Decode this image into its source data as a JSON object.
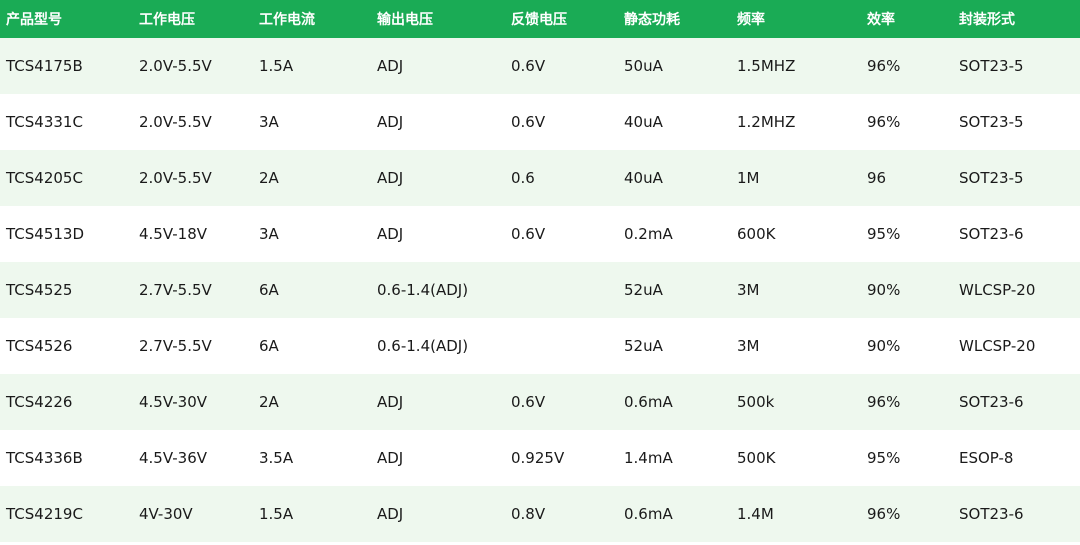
{
  "table": {
    "header_color": "#1aab55",
    "stripe_color": "#eef8ee",
    "columns": [
      "产品型号",
      "工作电压",
      "工作电流",
      "输出电压",
      "反馈电压",
      "静态功耗",
      "频率",
      "效率",
      "封装形式"
    ],
    "rows": [
      [
        "TCS4175B",
        "2.0V-5.5V",
        "1.5A",
        "ADJ",
        "0.6V",
        "50uA",
        "1.5MHZ",
        "96%",
        "SOT23-5"
      ],
      [
        "TCS4331C",
        "2.0V-5.5V",
        "3A",
        "ADJ",
        "0.6V",
        "40uA",
        "1.2MHZ",
        "96%",
        "SOT23-5"
      ],
      [
        "TCS4205C",
        "2.0V-5.5V",
        "2A",
        "ADJ",
        "0.6",
        "40uA",
        "1M",
        "96",
        "SOT23-5"
      ],
      [
        "TCS4513D",
        "4.5V-18V",
        "3A",
        "ADJ",
        "0.6V",
        "0.2mA",
        "600K",
        "95%",
        "SOT23-6"
      ],
      [
        "TCS4525",
        "2.7V-5.5V",
        "6A",
        "0.6-1.4(ADJ)",
        "",
        "52uA",
        "3M",
        "90%",
        "WLCSP-20"
      ],
      [
        "TCS4526",
        "2.7V-5.5V",
        "6A",
        "0.6-1.4(ADJ)",
        "",
        "52uA",
        "3M",
        "90%",
        "WLCSP-20"
      ],
      [
        "TCS4226",
        "4.5V-30V",
        "2A",
        "ADJ",
        "0.6V",
        "0.6mA",
        "500k",
        "96%",
        "SOT23-6"
      ],
      [
        "TCS4336B",
        "4.5V-36V",
        "3.5A",
        "ADJ",
        "0.925V",
        "1.4mA",
        "500K",
        "95%",
        "ESOP-8"
      ],
      [
        "TCS4219C",
        "4V-30V",
        "1.5A",
        "ADJ",
        "0.8V",
        "0.6mA",
        "1.4M",
        "96%",
        "SOT23-6"
      ]
    ]
  }
}
